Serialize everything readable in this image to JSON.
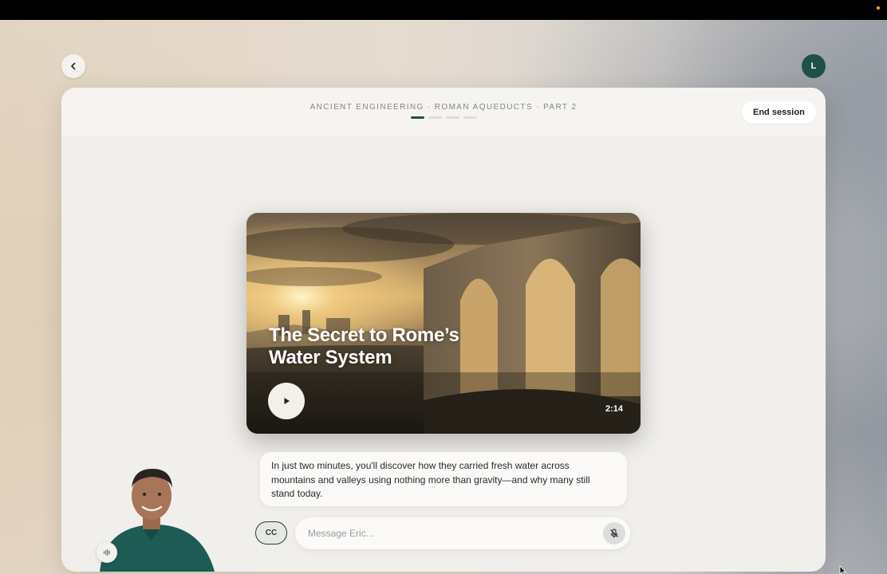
{
  "header": {
    "breadcrumb": "ANCIENT ENGINEERING · ROMAN AQUEDUCTS · PART 2",
    "progress": {
      "current_step": 1,
      "total_steps": 4
    },
    "end_session_label": "End session"
  },
  "user": {
    "avatar_initial": "L"
  },
  "video": {
    "title_line1": "The Secret to Rome’s",
    "title_line2": "Water System",
    "duration": "2:14"
  },
  "caption": {
    "text": "In just two minutes, you'll discover how they carried fresh water across mountains and valleys using nothing more than gravity—and why many still stand today."
  },
  "composer": {
    "cc_label": "CC",
    "placeholder": "Message Eric..."
  },
  "icons": {
    "back": "chevron-left-icon",
    "play": "play-icon",
    "mic": "mic-off-icon",
    "audio": "waveform-icon"
  },
  "colors": {
    "accent": "#1f5148",
    "panel": "#f1efeb"
  }
}
